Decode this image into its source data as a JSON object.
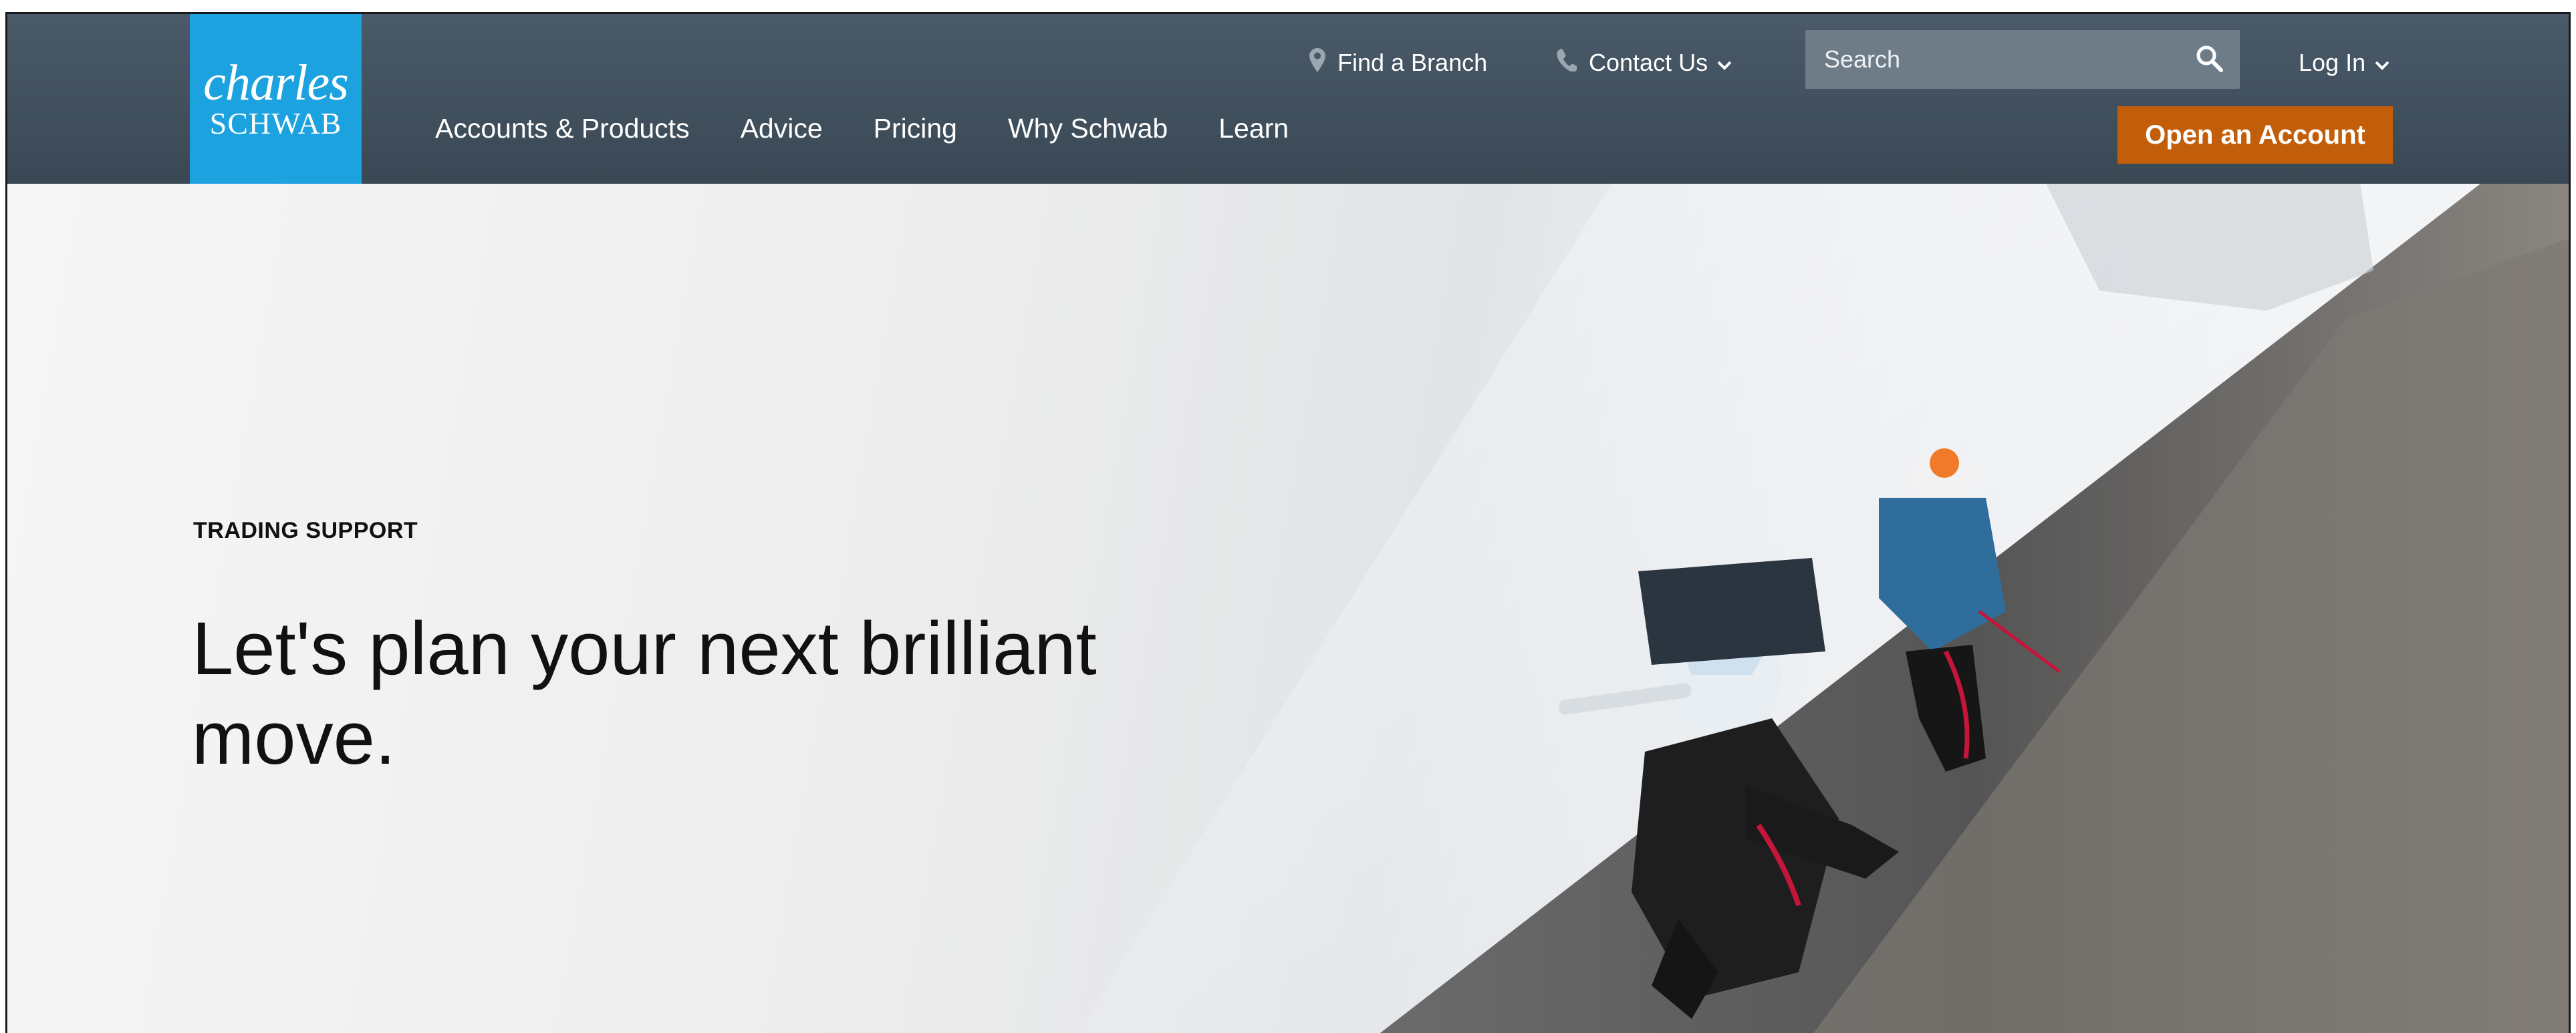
{
  "brand": {
    "logo_line1": "charles",
    "logo_line2": "SCHWAB",
    "color": "#1da2e0"
  },
  "utility": {
    "find_branch": "Find a Branch",
    "contact_us": "Contact Us",
    "search_placeholder": "Search",
    "log_in": "Log In"
  },
  "nav": {
    "items": [
      {
        "label": "Accounts & Products"
      },
      {
        "label": "Advice"
      },
      {
        "label": "Pricing"
      },
      {
        "label": "Why Schwab"
      },
      {
        "label": "Learn"
      }
    ]
  },
  "cta": {
    "label": "Open an Account",
    "color": "#c25e0a"
  },
  "hero": {
    "eyebrow": "TRADING SUPPORT",
    "headline": "Let's plan your next brilliant move."
  },
  "icons": [
    "map-pin-icon",
    "phone-icon",
    "chevron-down-icon",
    "search-icon"
  ]
}
